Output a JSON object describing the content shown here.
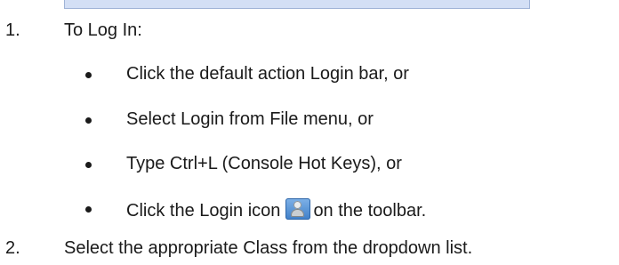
{
  "steps": [
    {
      "number": "1.",
      "text": "To Log In:",
      "options": [
        {
          "text": "Click the default action Login bar, or"
        },
        {
          "text": "Select Login from File menu, or"
        },
        {
          "text": "Type Ctrl+L (Console Hot Keys), or"
        },
        {
          "text_before_icon": "Click the Login icon",
          "icon": "login-icon",
          "text_after_icon": "on the toolbar."
        }
      ]
    },
    {
      "number": "2.",
      "text": "Select the appropriate Class from the dropdown list."
    }
  ]
}
